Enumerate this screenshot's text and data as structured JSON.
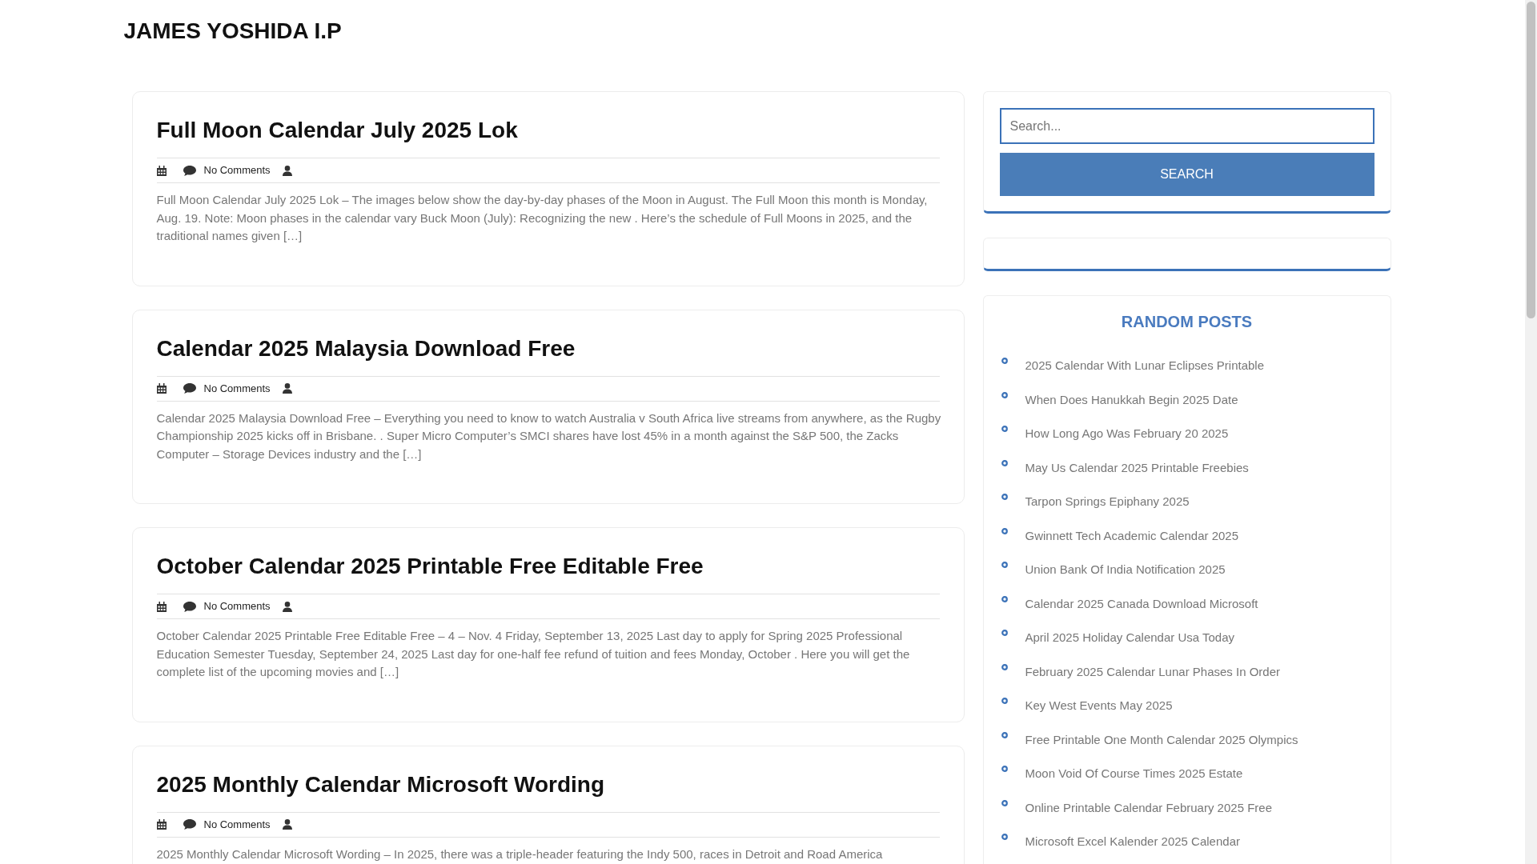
{
  "site": {
    "title": "JAMES YOSHIDA I.P"
  },
  "posts": [
    {
      "title": "Full Moon Calendar July 2025 Lok",
      "comments": "No Comments",
      "excerpt": "Full Moon Calendar July 2025 Lok – The images below show the day-by-day phases of the Moon in August. The Full Moon this month is Monday, Aug. 19. Note: Moon phases in the calendar vary Buck Moon (July): Recognizing the new . Here’s the schedule of Full Moons in 2025, and the traditional names given […]"
    },
    {
      "title": "Calendar 2025 Malaysia Download Free",
      "comments": "No Comments",
      "excerpt": "Calendar 2025 Malaysia Download Free – Everything you need to know to watch Australia v South Africa live streams from anywhere, as the Rugby Championship 2025 kicks off in Brisbane. . Super Micro Computer’s SMCI shares have lost 45% in a month against the S&P 500, the Zacks Computer – Storage Devices industry and the […]"
    },
    {
      "title": "October Calendar 2025 Printable Free Editable Free",
      "comments": "No Comments",
      "excerpt": "October Calendar 2025 Printable Free Editable Free – 4 – Nov. 4 Friday, September 13, 2025 Last day to apply for Spring 2025 Professional Education Semester Tuesday, September 24, 2025 Last day for one-half fee refund of tuition and fees Monday, October . Here you will get the complete list of the upcoming movies and […]"
    },
    {
      "title": "2025 Monthly Calendar Microsoft Wording",
      "comments": "No Comments",
      "excerpt": "2025 Monthly Calendar Microsoft Wording – In 2025, there was a triple-header featuring the Indy 500, races in Detroit and Road America"
    }
  ],
  "sidebar": {
    "search": {
      "placeholder": "Search...",
      "button": "SEARCH"
    },
    "random_posts": {
      "title": "RANDOM POSTS",
      "items": [
        "2025 Calendar With Lunar Eclipses Printable",
        "When Does Hanukkah Begin 2025 Date",
        "How Long Ago Was February 20 2025",
        "May Us Calendar 2025 Printable Freebies",
        "Tarpon Springs Epiphany 2025",
        "Gwinnett Tech Academic Calendar 2025",
        "Union Bank Of India Notification 2025",
        "Calendar 2025 Canada Download Microsoft",
        "April 2025 Holiday Calendar Usa Today",
        "February 2025 Calendar Lunar Phases In Order",
        "Key West Events May 2025",
        "Free Printable One Month Calendar 2025 Olympics",
        "Moon Void Of Course Times 2025 Estate",
        "Online Printable Calendar February 2025 Free",
        "Microsoft Excel Kalender 2025 Calendar"
      ]
    }
  }
}
